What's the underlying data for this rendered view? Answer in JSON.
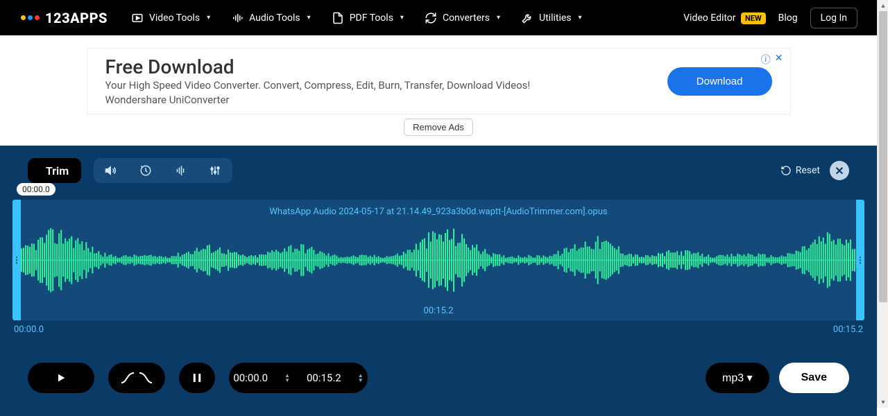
{
  "brand": "123APPS",
  "nav": [
    {
      "label": "Video Tools",
      "icon": "video-icon"
    },
    {
      "label": "Audio Tools",
      "icon": "audio-icon"
    },
    {
      "label": "PDF Tools",
      "icon": "pdf-icon"
    },
    {
      "label": "Converters",
      "icon": "convert-icon"
    },
    {
      "label": "Utilities",
      "icon": "utility-icon"
    }
  ],
  "nav_right": {
    "video_editor": "Video Editor",
    "new_badge": "NEW",
    "blog": "Blog",
    "login": "Log In"
  },
  "ad": {
    "title": "Free Download",
    "desc": "Your High Speed Video Converter. Convert, Compress, Edit, Burn, Transfer, Download Videos! Wondershare UniConverter",
    "cta": "Download",
    "remove": "Remove Ads"
  },
  "editor": {
    "active_tool": "Trim",
    "reset": "Reset",
    "filename": "WhatsApp Audio 2024-05-17 at 21.14.49_923a3b0d.waptt-[AudioTrimmer.com].opus",
    "bubble_time": "00:00.0",
    "start_time": "00:00.0",
    "end_time": "00:15.2",
    "duration": "00:15.2",
    "format": "mp3 ▾",
    "save": "Save"
  }
}
